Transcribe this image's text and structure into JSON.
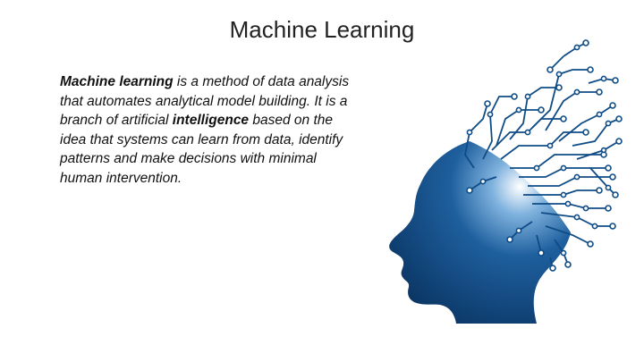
{
  "slide": {
    "title": "Machine Learning",
    "paragraph": {
      "term": "Machine learning",
      "line1_rest": " is a method of data analysis",
      "line2": "that automates analytical model building. It is a",
      "line3_pre": "branch of artificial ",
      "line3_bold": "intelligence",
      "line3_post": " based on the",
      "line4": "idea that systems can learn from data, identify",
      "line5": "patterns and make decisions with minimal",
      "line6": "human intervention."
    },
    "illustration": {
      "icon": "ai-head-circuit-icon",
      "colors": {
        "dark": "#0b3f73",
        "mid": "#1a5fa0",
        "light": "#ffffff"
      }
    }
  }
}
